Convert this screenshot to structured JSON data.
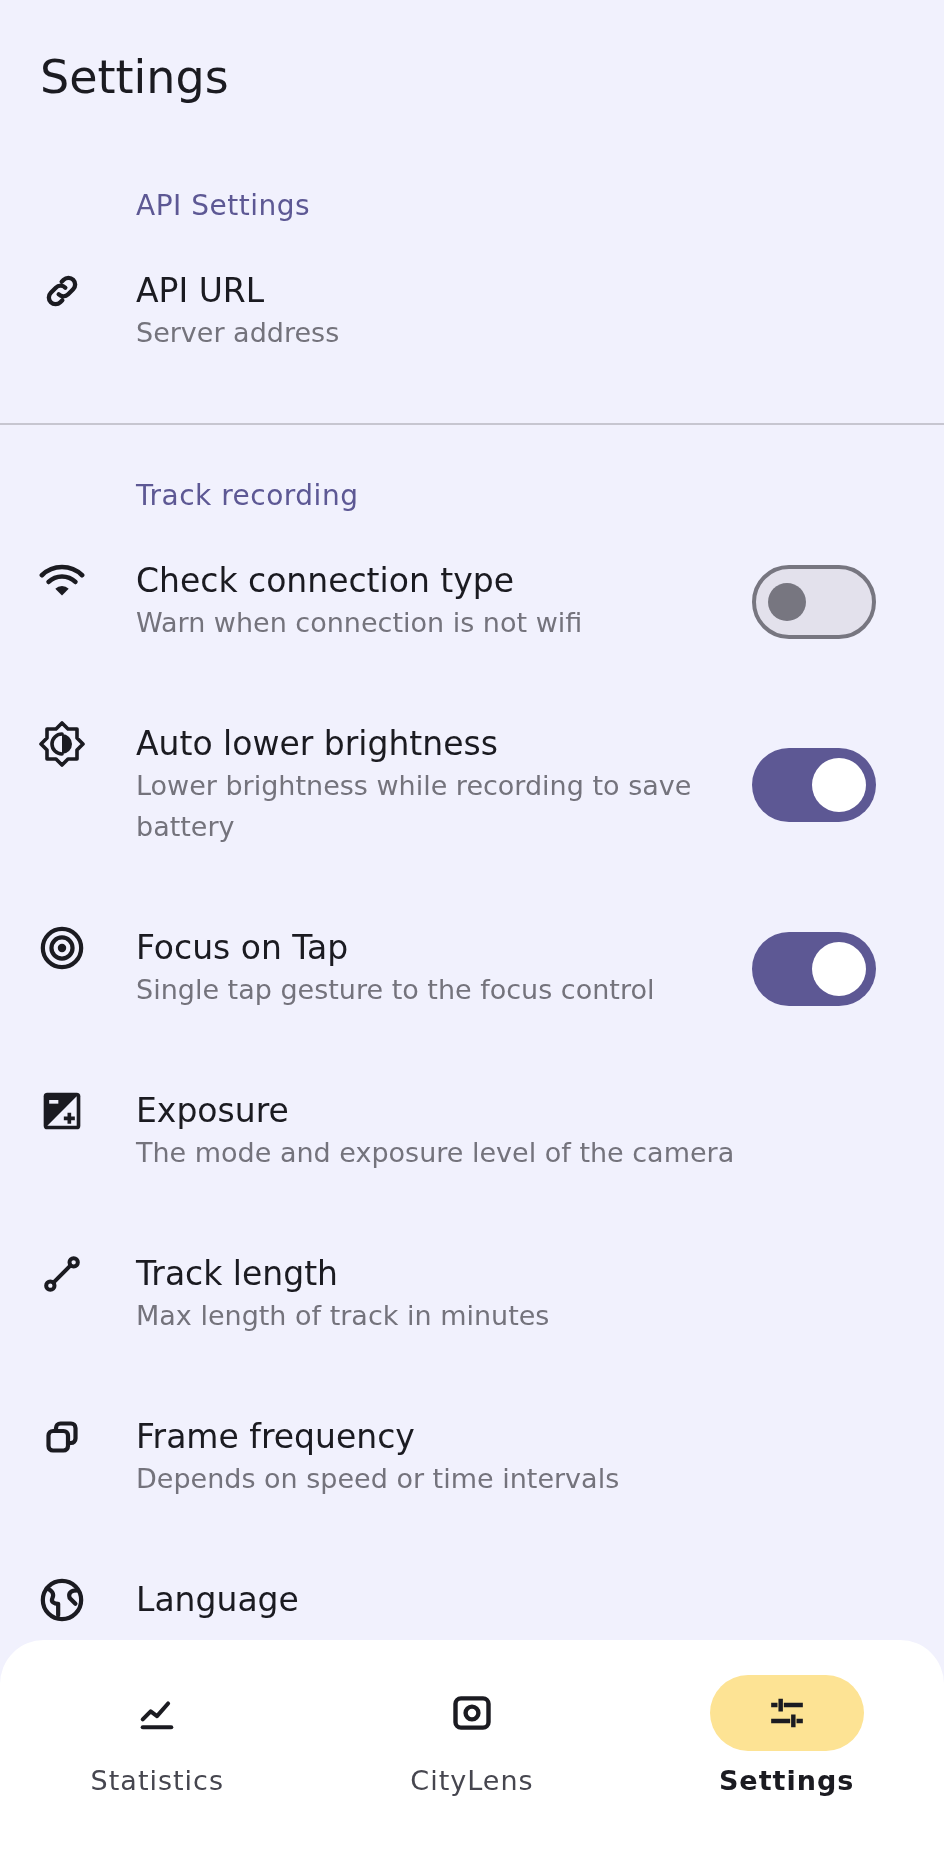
{
  "screen_title": "Settings",
  "sections": [
    {
      "header": "API Settings",
      "items": [
        {
          "kind": "link",
          "title": "API URL",
          "subtitle": "Server address"
        }
      ]
    },
    {
      "header": "Track recording",
      "items": [
        {
          "kind": "switch",
          "title": "Check connection type",
          "subtitle": "Warn when connection is not wifi",
          "on": false
        },
        {
          "kind": "switch",
          "title": "Auto lower brightness",
          "subtitle": "Lower brightness while recording to save battery",
          "on": true
        },
        {
          "kind": "switch",
          "title": "Focus on Tap",
          "subtitle": "Single tap gesture to the focus control",
          "on": true
        },
        {
          "kind": "link",
          "title": "Exposure",
          "subtitle": "The mode and exposure level of the camera"
        },
        {
          "kind": "link",
          "title": "Track length",
          "subtitle": "Max length of track in minutes"
        },
        {
          "kind": "link",
          "title": "Frame frequency",
          "subtitle": "Depends on speed or time intervals"
        },
        {
          "kind": "link",
          "title": "Language"
        }
      ]
    }
  ],
  "bottom_nav": [
    {
      "label": "Statistics",
      "selected": false
    },
    {
      "label": "CityLens",
      "selected": false
    },
    {
      "label": "Settings",
      "selected": true
    }
  ]
}
